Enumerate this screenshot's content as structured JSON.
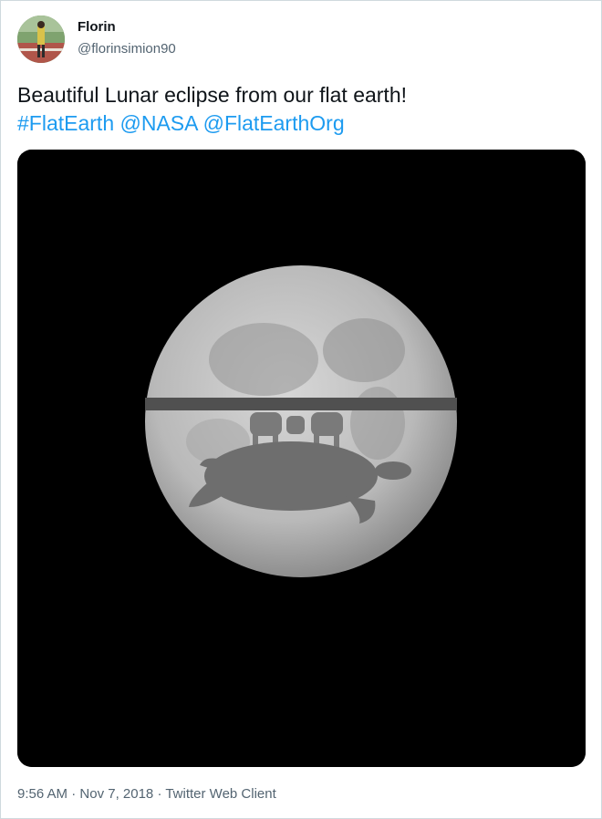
{
  "author": {
    "display_name": "Florin",
    "handle": "@florinsimion90"
  },
  "tweet": {
    "text": "Beautiful Lunar eclipse from our flat earth!",
    "hashtag": "#FlatEarth",
    "mention_1": "@NASA",
    "mention_2": "@FlatEarthOrg"
  },
  "meta": {
    "time": "9:56 AM",
    "separator": " · ",
    "date": "Nov 7, 2018",
    "client": "Twitter Web Client"
  },
  "colors": {
    "link": "#1d9bf0",
    "text": "#0f1419",
    "secondary": "#536471",
    "border": "#cfd9de"
  }
}
